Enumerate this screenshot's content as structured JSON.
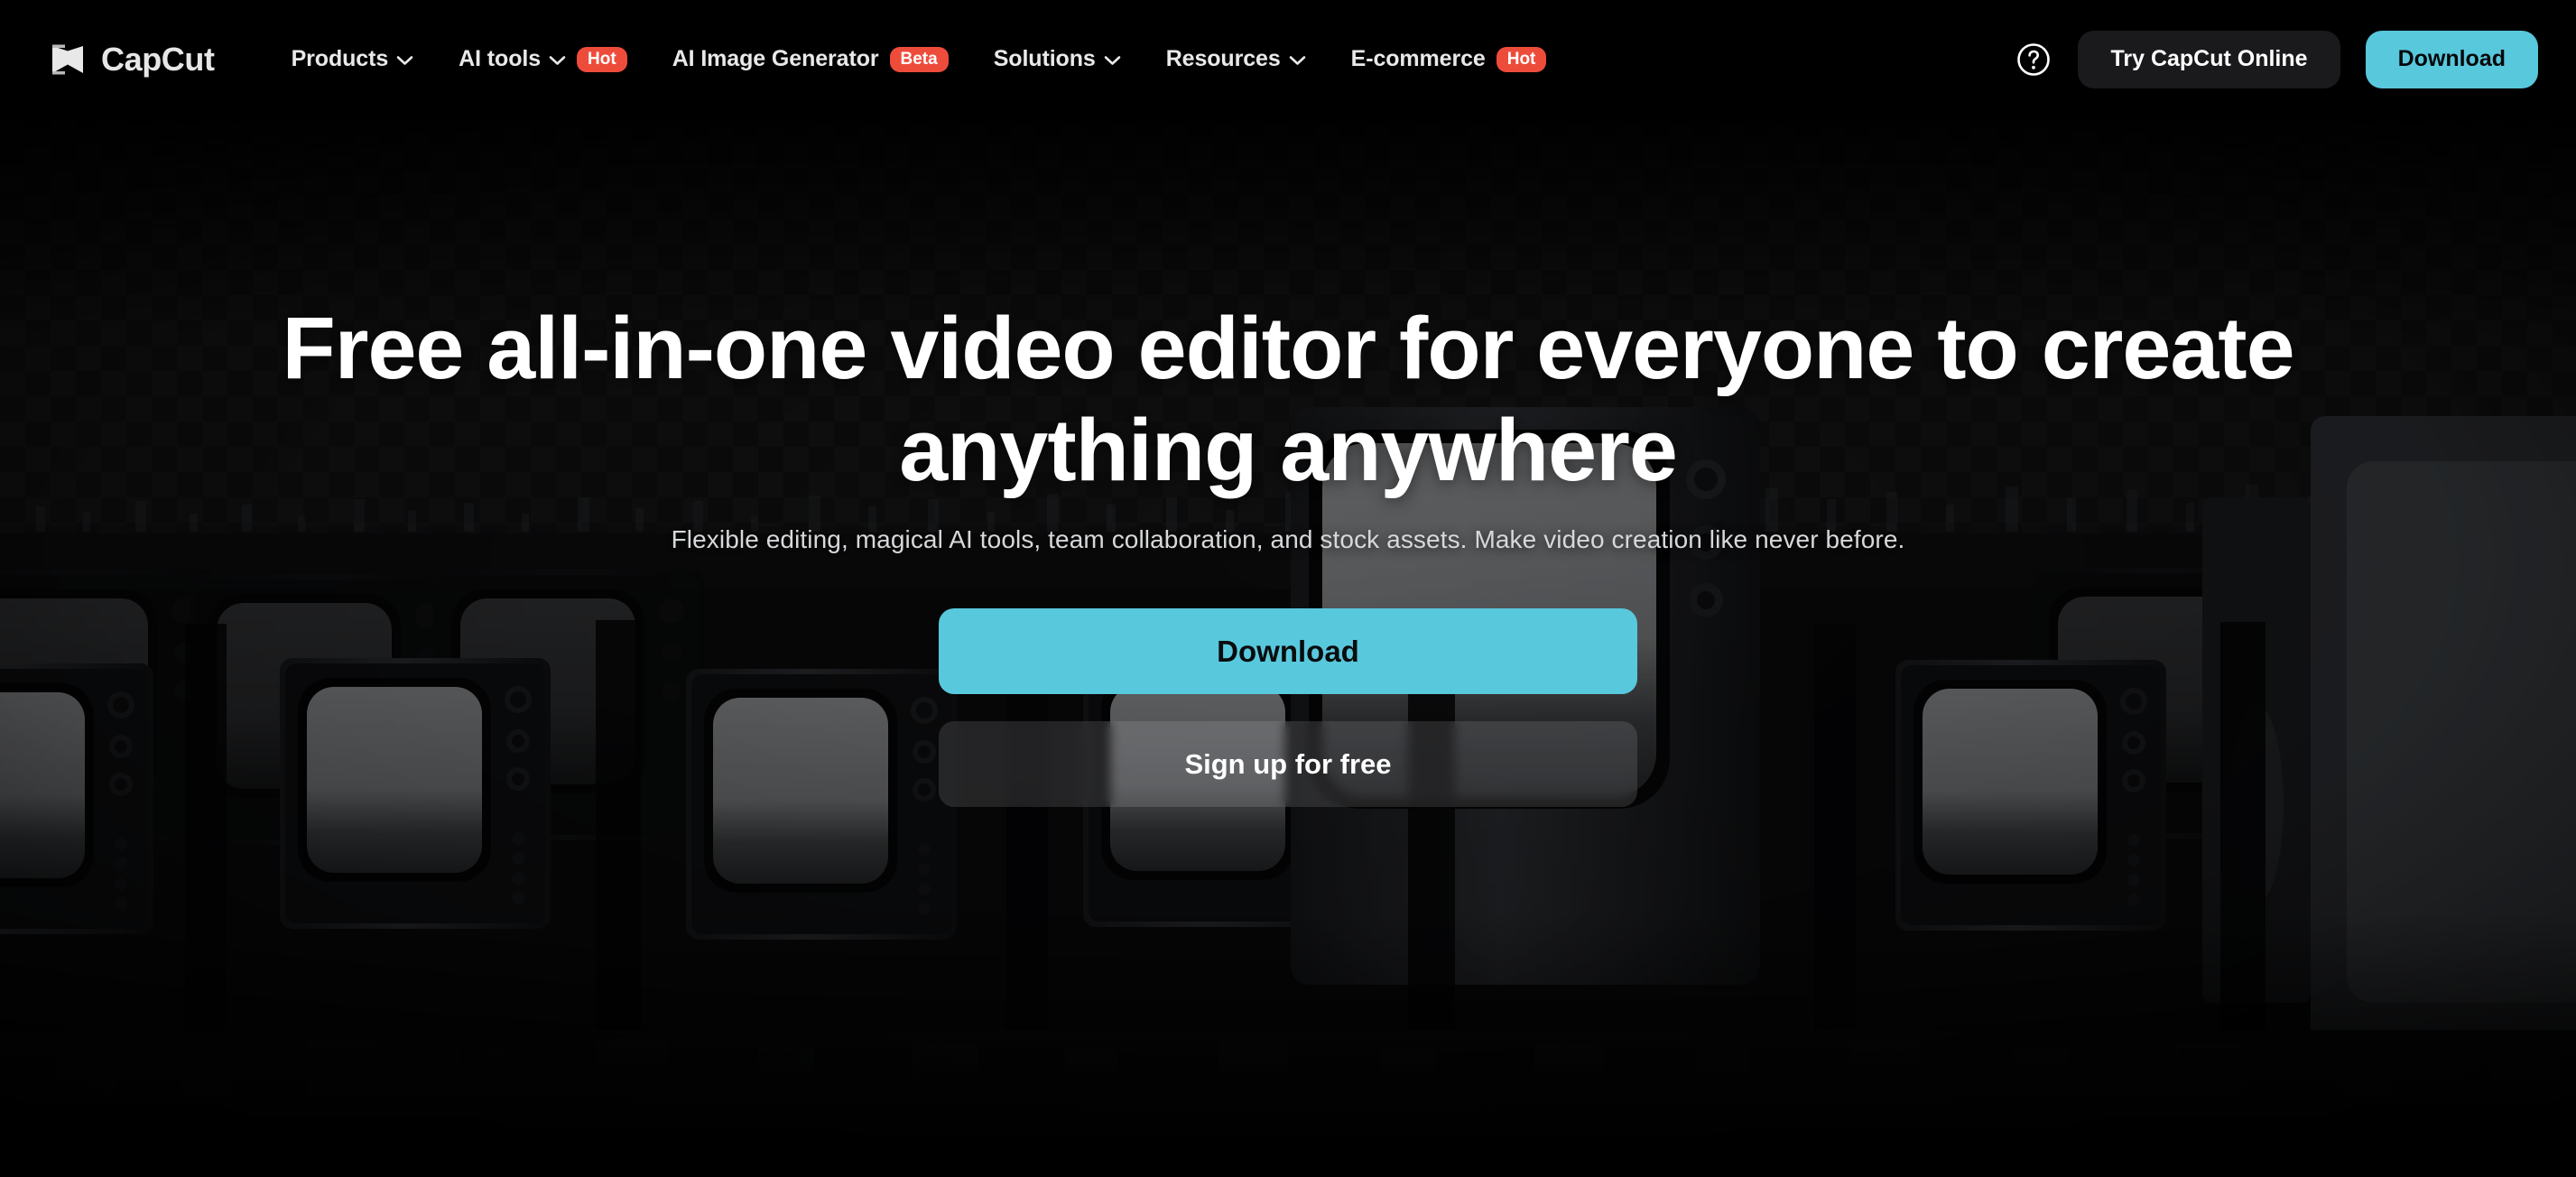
{
  "brand": {
    "name": "CapCut",
    "logo_icon": "capcut-hourglass-logo"
  },
  "nav": {
    "items": [
      {
        "label": "Products",
        "has_dropdown": true,
        "badge": null,
        "icon": "chevron-down-icon"
      },
      {
        "label": "AI tools",
        "has_dropdown": true,
        "badge": "Hot",
        "icon": "chevron-down-icon"
      },
      {
        "label": "AI Image Generator",
        "has_dropdown": false,
        "badge": "Beta",
        "icon": null
      },
      {
        "label": "Solutions",
        "has_dropdown": true,
        "badge": null,
        "icon": "chevron-down-icon"
      },
      {
        "label": "Resources",
        "has_dropdown": true,
        "badge": null,
        "icon": "chevron-down-icon"
      },
      {
        "label": "E-commerce",
        "has_dropdown": false,
        "badge": "Hot",
        "icon": null
      }
    ],
    "help_icon": "question-circle-icon",
    "try_online_label": "Try CapCut Online",
    "download_label": "Download"
  },
  "hero": {
    "headline": "Free all-in-one video editor for everyone to create anything anywhere",
    "subheadline": "Flexible editing, magical AI tools, team collaboration, and stock assets. Make video creation like never before.",
    "primary_cta": "Download",
    "secondary_cta": "Sign up for free",
    "background_description": "dark-retro-tv-wall-photo"
  },
  "colors": {
    "accent": "#58c8dd",
    "badge_hot": "#ee4c3b",
    "badge_beta": "#ee4c3b",
    "nav_background": "#000000",
    "ghost_button": "#1a1a1c",
    "text_primary": "#ffffff",
    "text_secondary": "#d7d8da"
  }
}
